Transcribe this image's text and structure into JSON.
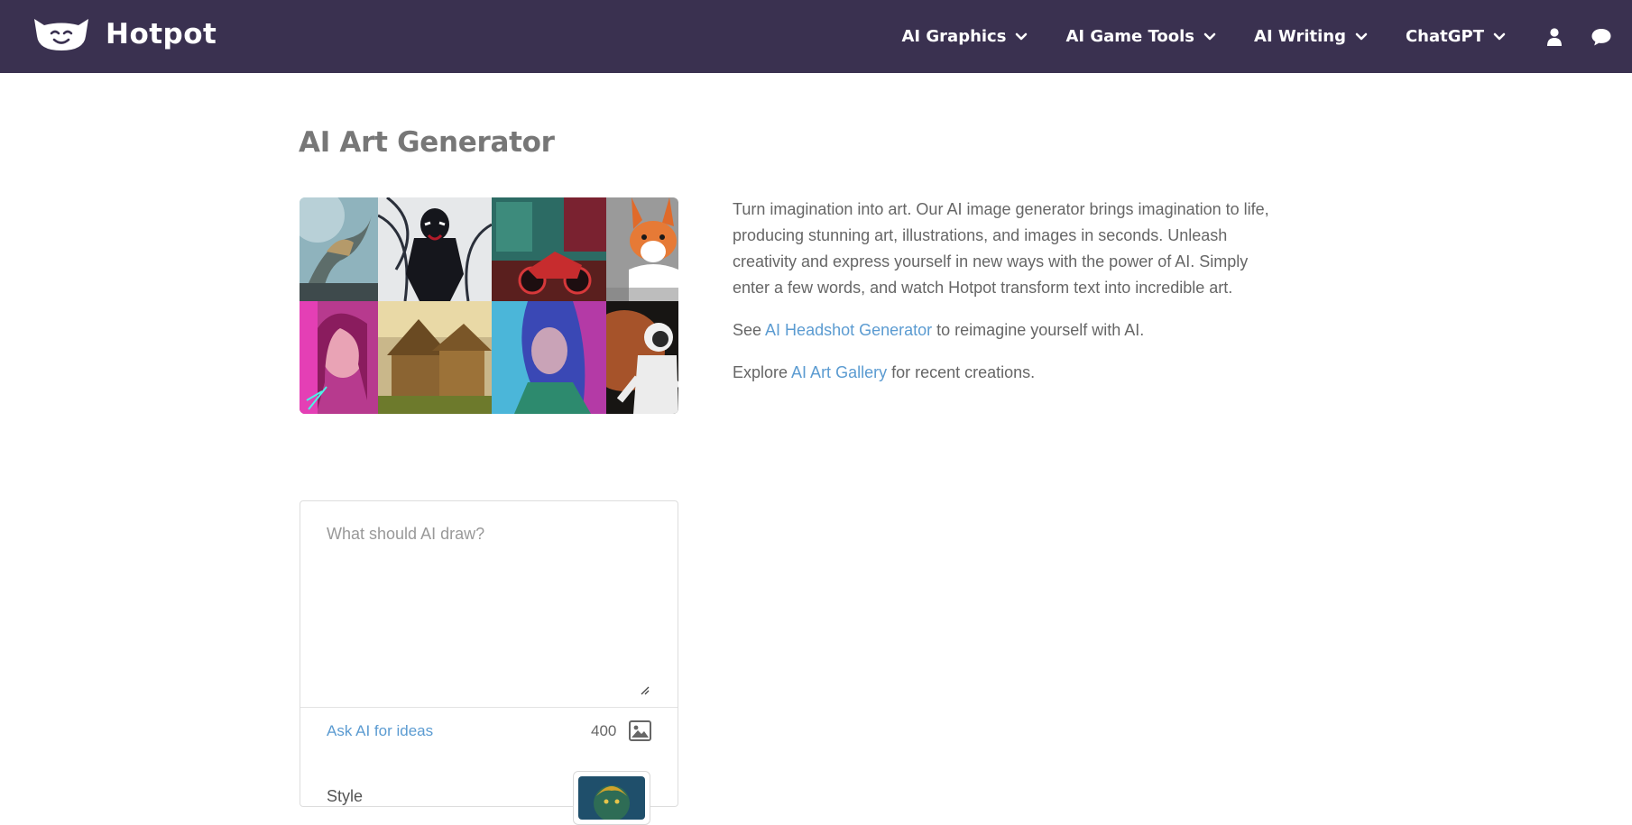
{
  "header": {
    "brand": "Hotpot",
    "nav": [
      {
        "label": "AI Graphics"
      },
      {
        "label": "AI Game Tools"
      },
      {
        "label": "AI Writing"
      },
      {
        "label": "ChatGPT"
      }
    ],
    "icons": [
      "user-icon",
      "chat-bubble-icon"
    ],
    "background": "#3a3150"
  },
  "main": {
    "title": "AI Art Generator",
    "intro": {
      "paragraph": "Turn imagination into art. Our AI image generator brings imagination to life, producing stunning art, illustrations, and images in seconds. Unleash creativity and express yourself in new ways with the power of AI. Simply enter a few words, and watch Hotpot transform text into incredible art.",
      "headshot_prefix": "See ",
      "headshot_link": "AI Headshot Generator",
      "headshot_suffix": " to reimagine yourself with AI.",
      "gallery_prefix": "Explore ",
      "gallery_link": "AI Art Gallery",
      "gallery_suffix": " for recent creations."
    },
    "link_color": "#5b9bd1"
  },
  "prompt": {
    "placeholder": "What should AI draw?",
    "value": "",
    "ideas_label": "Ask AI for ideas",
    "char_limit": "400",
    "style_label": "Style"
  }
}
